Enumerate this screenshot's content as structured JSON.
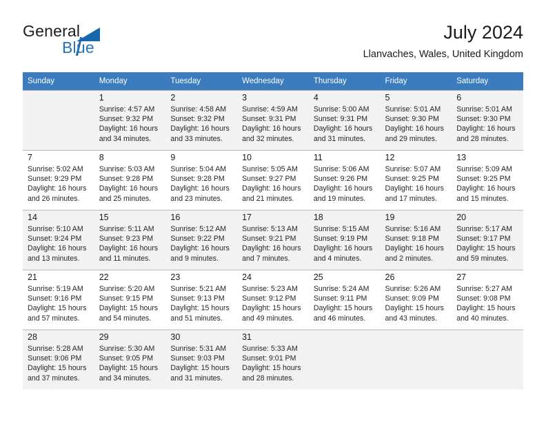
{
  "brand": {
    "name_part1": "General",
    "name_part2": "Blue",
    "logo_icon": "triangle-logo-icon",
    "accent_color": "#1767ae"
  },
  "header": {
    "month_title": "July 2024",
    "location": "Llanvaches, Wales, United Kingdom"
  },
  "calendar": {
    "header_bg": "#3a7cbe",
    "shaded_row_bg": "#f2f2f2",
    "weekday_headers": [
      "Sunday",
      "Monday",
      "Tuesday",
      "Wednesday",
      "Thursday",
      "Friday",
      "Saturday"
    ],
    "weeks": [
      [
        {
          "day": "",
          "sunrise": "",
          "sunset": "",
          "daylight1": "",
          "daylight2": ""
        },
        {
          "day": "1",
          "sunrise": "Sunrise: 4:57 AM",
          "sunset": "Sunset: 9:32 PM",
          "daylight1": "Daylight: 16 hours",
          "daylight2": "and 34 minutes."
        },
        {
          "day": "2",
          "sunrise": "Sunrise: 4:58 AM",
          "sunset": "Sunset: 9:32 PM",
          "daylight1": "Daylight: 16 hours",
          "daylight2": "and 33 minutes."
        },
        {
          "day": "3",
          "sunrise": "Sunrise: 4:59 AM",
          "sunset": "Sunset: 9:31 PM",
          "daylight1": "Daylight: 16 hours",
          "daylight2": "and 32 minutes."
        },
        {
          "day": "4",
          "sunrise": "Sunrise: 5:00 AM",
          "sunset": "Sunset: 9:31 PM",
          "daylight1": "Daylight: 16 hours",
          "daylight2": "and 31 minutes."
        },
        {
          "day": "5",
          "sunrise": "Sunrise: 5:01 AM",
          "sunset": "Sunset: 9:30 PM",
          "daylight1": "Daylight: 16 hours",
          "daylight2": "and 29 minutes."
        },
        {
          "day": "6",
          "sunrise": "Sunrise: 5:01 AM",
          "sunset": "Sunset: 9:30 PM",
          "daylight1": "Daylight: 16 hours",
          "daylight2": "and 28 minutes."
        }
      ],
      [
        {
          "day": "7",
          "sunrise": "Sunrise: 5:02 AM",
          "sunset": "Sunset: 9:29 PM",
          "daylight1": "Daylight: 16 hours",
          "daylight2": "and 26 minutes."
        },
        {
          "day": "8",
          "sunrise": "Sunrise: 5:03 AM",
          "sunset": "Sunset: 9:28 PM",
          "daylight1": "Daylight: 16 hours",
          "daylight2": "and 25 minutes."
        },
        {
          "day": "9",
          "sunrise": "Sunrise: 5:04 AM",
          "sunset": "Sunset: 9:28 PM",
          "daylight1": "Daylight: 16 hours",
          "daylight2": "and 23 minutes."
        },
        {
          "day": "10",
          "sunrise": "Sunrise: 5:05 AM",
          "sunset": "Sunset: 9:27 PM",
          "daylight1": "Daylight: 16 hours",
          "daylight2": "and 21 minutes."
        },
        {
          "day": "11",
          "sunrise": "Sunrise: 5:06 AM",
          "sunset": "Sunset: 9:26 PM",
          "daylight1": "Daylight: 16 hours",
          "daylight2": "and 19 minutes."
        },
        {
          "day": "12",
          "sunrise": "Sunrise: 5:07 AM",
          "sunset": "Sunset: 9:25 PM",
          "daylight1": "Daylight: 16 hours",
          "daylight2": "and 17 minutes."
        },
        {
          "day": "13",
          "sunrise": "Sunrise: 5:09 AM",
          "sunset": "Sunset: 9:25 PM",
          "daylight1": "Daylight: 16 hours",
          "daylight2": "and 15 minutes."
        }
      ],
      [
        {
          "day": "14",
          "sunrise": "Sunrise: 5:10 AM",
          "sunset": "Sunset: 9:24 PM",
          "daylight1": "Daylight: 16 hours",
          "daylight2": "and 13 minutes."
        },
        {
          "day": "15",
          "sunrise": "Sunrise: 5:11 AM",
          "sunset": "Sunset: 9:23 PM",
          "daylight1": "Daylight: 16 hours",
          "daylight2": "and 11 minutes."
        },
        {
          "day": "16",
          "sunrise": "Sunrise: 5:12 AM",
          "sunset": "Sunset: 9:22 PM",
          "daylight1": "Daylight: 16 hours",
          "daylight2": "and 9 minutes."
        },
        {
          "day": "17",
          "sunrise": "Sunrise: 5:13 AM",
          "sunset": "Sunset: 9:21 PM",
          "daylight1": "Daylight: 16 hours",
          "daylight2": "and 7 minutes."
        },
        {
          "day": "18",
          "sunrise": "Sunrise: 5:15 AM",
          "sunset": "Sunset: 9:19 PM",
          "daylight1": "Daylight: 16 hours",
          "daylight2": "and 4 minutes."
        },
        {
          "day": "19",
          "sunrise": "Sunrise: 5:16 AM",
          "sunset": "Sunset: 9:18 PM",
          "daylight1": "Daylight: 16 hours",
          "daylight2": "and 2 minutes."
        },
        {
          "day": "20",
          "sunrise": "Sunrise: 5:17 AM",
          "sunset": "Sunset: 9:17 PM",
          "daylight1": "Daylight: 15 hours",
          "daylight2": "and 59 minutes."
        }
      ],
      [
        {
          "day": "21",
          "sunrise": "Sunrise: 5:19 AM",
          "sunset": "Sunset: 9:16 PM",
          "daylight1": "Daylight: 15 hours",
          "daylight2": "and 57 minutes."
        },
        {
          "day": "22",
          "sunrise": "Sunrise: 5:20 AM",
          "sunset": "Sunset: 9:15 PM",
          "daylight1": "Daylight: 15 hours",
          "daylight2": "and 54 minutes."
        },
        {
          "day": "23",
          "sunrise": "Sunrise: 5:21 AM",
          "sunset": "Sunset: 9:13 PM",
          "daylight1": "Daylight: 15 hours",
          "daylight2": "and 51 minutes."
        },
        {
          "day": "24",
          "sunrise": "Sunrise: 5:23 AM",
          "sunset": "Sunset: 9:12 PM",
          "daylight1": "Daylight: 15 hours",
          "daylight2": "and 49 minutes."
        },
        {
          "day": "25",
          "sunrise": "Sunrise: 5:24 AM",
          "sunset": "Sunset: 9:11 PM",
          "daylight1": "Daylight: 15 hours",
          "daylight2": "and 46 minutes."
        },
        {
          "day": "26",
          "sunrise": "Sunrise: 5:26 AM",
          "sunset": "Sunset: 9:09 PM",
          "daylight1": "Daylight: 15 hours",
          "daylight2": "and 43 minutes."
        },
        {
          "day": "27",
          "sunrise": "Sunrise: 5:27 AM",
          "sunset": "Sunset: 9:08 PM",
          "daylight1": "Daylight: 15 hours",
          "daylight2": "and 40 minutes."
        }
      ],
      [
        {
          "day": "28",
          "sunrise": "Sunrise: 5:28 AM",
          "sunset": "Sunset: 9:06 PM",
          "daylight1": "Daylight: 15 hours",
          "daylight2": "and 37 minutes."
        },
        {
          "day": "29",
          "sunrise": "Sunrise: 5:30 AM",
          "sunset": "Sunset: 9:05 PM",
          "daylight1": "Daylight: 15 hours",
          "daylight2": "and 34 minutes."
        },
        {
          "day": "30",
          "sunrise": "Sunrise: 5:31 AM",
          "sunset": "Sunset: 9:03 PM",
          "daylight1": "Daylight: 15 hours",
          "daylight2": "and 31 minutes."
        },
        {
          "day": "31",
          "sunrise": "Sunrise: 5:33 AM",
          "sunset": "Sunset: 9:01 PM",
          "daylight1": "Daylight: 15 hours",
          "daylight2": "and 28 minutes."
        },
        {
          "day": "",
          "sunrise": "",
          "sunset": "",
          "daylight1": "",
          "daylight2": ""
        },
        {
          "day": "",
          "sunrise": "",
          "sunset": "",
          "daylight1": "",
          "daylight2": ""
        },
        {
          "day": "",
          "sunrise": "",
          "sunset": "",
          "daylight1": "",
          "daylight2": ""
        }
      ]
    ]
  }
}
